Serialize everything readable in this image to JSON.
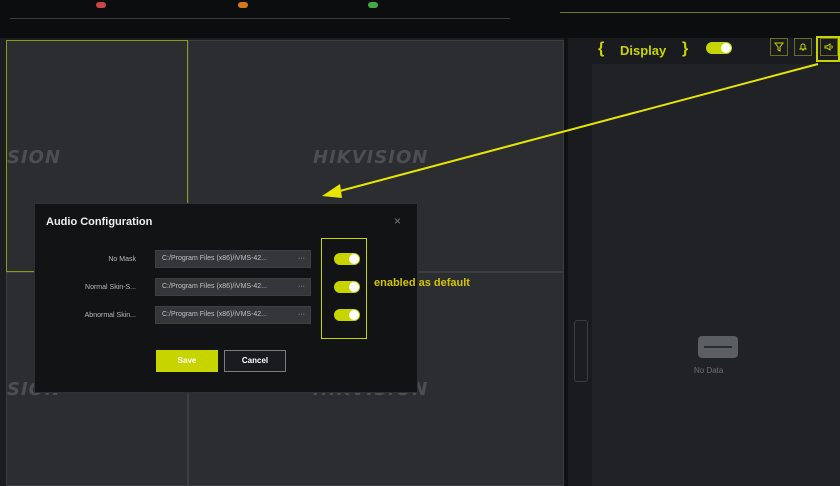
{
  "display": {
    "label": "Display"
  },
  "watermark": {
    "text": "HIKVISION",
    "partial_left": "SION"
  },
  "right_panel": {
    "no_data": "No Data"
  },
  "dialog": {
    "title": "Audio Configuration",
    "close": "×",
    "rows": [
      {
        "label": "No Mask",
        "path": "C:/Program Files (x86)/iVMS-42...",
        "more": "···",
        "enabled": true
      },
      {
        "label": "Normal Skin-S...",
        "path": "C:/Program Files (x86)/iVMS-42...",
        "more": "···",
        "enabled": true
      },
      {
        "label": "Abnormal Skin...",
        "path": "C:/Program Files (x86)/iVMS-42...",
        "more": "···",
        "enabled": true
      }
    ],
    "save": "Save",
    "cancel": "Cancel"
  },
  "annotation": {
    "note": "enabled as default"
  },
  "colors": {
    "accent": "#c8d400",
    "dialog_bg": "#121315",
    "canvas": "#2b2d31"
  }
}
